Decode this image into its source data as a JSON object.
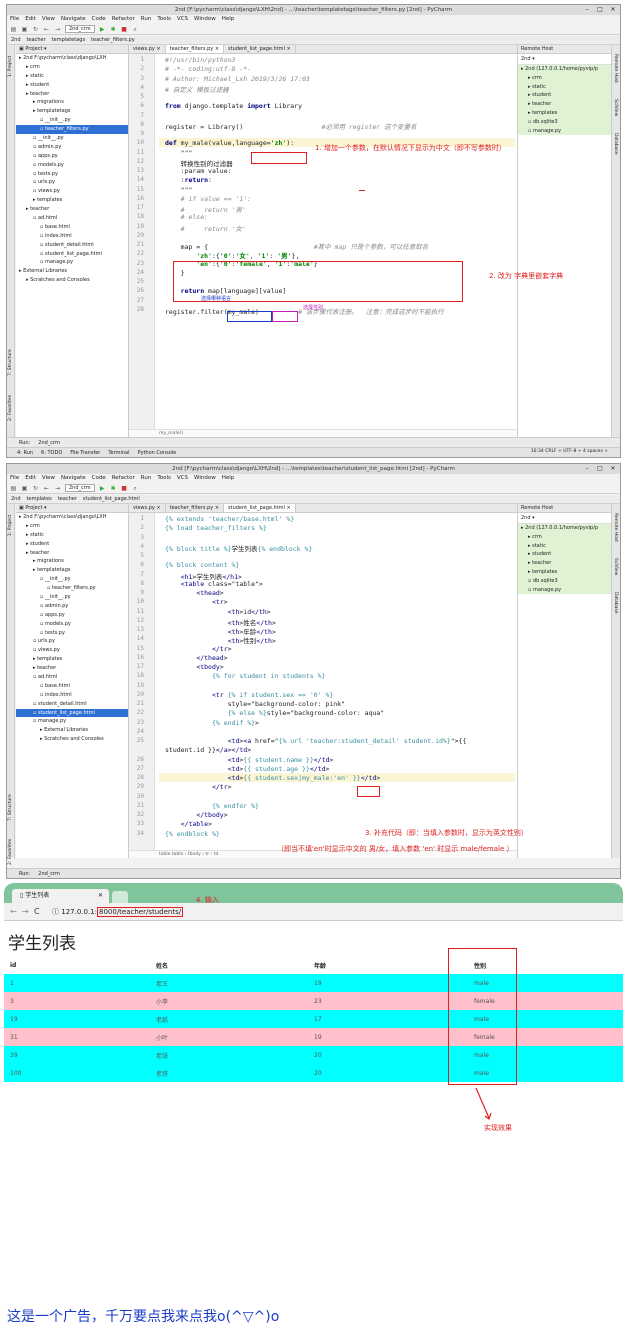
{
  "w1": {
    "title": "2nd [F:\\pycharm\\class\\django\\LXH\\2nd] - ...\\teacher\\templatetags\\teacher_filters.py [2nd] - PyCharm",
    "menu": [
      "File",
      "Edit",
      "View",
      "Navigate",
      "Code",
      "Refactor",
      "Run",
      "Tools",
      "VCS",
      "Window",
      "Help"
    ],
    "run_config": "2nd_crm",
    "crumbs": [
      "2nd",
      "teacher",
      "templatetags",
      "teacher_filters.py"
    ],
    "project_label": "Project",
    "tree": [
      "2nd  F:\\pycharm\\class\\django\\LXH",
      "crm",
      "static",
      "student",
      "teacher",
      "migrations",
      "templatetags",
      "__init__.py",
      "teacher_filters.py",
      "__init__.py",
      "admin.py",
      "apps.py",
      "models.py",
      "tests.py",
      "urls.py",
      "views.py",
      "templates",
      "teacher",
      "ad.html",
      "base.html",
      "index.html",
      "student_detail.html",
      "student_list_page.html",
      "manage.py",
      "External Libraries",
      "Scratches and Consoles"
    ],
    "tabs": [
      "views.py",
      "teacher_filters.py",
      "student_list_page.html"
    ],
    "code": [
      "#!/usr/bin/python3",
      "# -*- coding:utf-8 -*-",
      "# Author: Michael_Lxh 2019/3/26 17:03",
      "# 自定义 模板过滤器",
      "",
      "from django.template import Library",
      "",
      "register = Library()                    #必须用 register 这个变量名",
      "",
      "def my_male(value,language='zh'):",
      "    \"\"\"",
      "    转换性别的过滤器",
      "    :param value:",
      "    :return:",
      "    \"\"\"",
      "    # if value == '1':",
      "    #     return '男'",
      "    # else:",
      "    #     return '女'",
      "",
      "    map = {                           #其中 map 只是个参数，可以任意取名",
      "        'zh':{'0':'女', '1': '男'},",
      "        'en':{'0':'female', '1':'male'}",
      "    }",
      "",
      "    return map[language][value]",
      "",
      "register.filter(my_male)          # 该步骤代表注册。  注意：完成这步时不能执行"
    ],
    "remote_title": "Remote Host",
    "remote_server": "2nd",
    "remote_tree": [
      "2nd (127.0.0.1/home/pyvip/p",
      "crm",
      "static",
      "student",
      "teacher",
      "templates",
      "db.sqlite3",
      "manage.py"
    ],
    "editor_footer": "my_male()",
    "run_label": "Run:",
    "run_tab": "2nd_crm",
    "bottom_tabs": [
      "4: Run",
      "6: TODO",
      "File Transfer",
      "Terminal",
      "Python Console"
    ],
    "status": "10:34  CRLF ÷  UTF-8 ÷  4 spaces ÷",
    "event_log": "Event Log",
    "side_left": [
      "1: Project",
      "7: Structure",
      "2: Favorites"
    ],
    "side_right": [
      "Remote Host",
      "SciView",
      "Database"
    ],
    "ann1": "1. 增加一个参数，在默认情况下显示为中文（即不写参数时）",
    "ann2": "2. 改为 字典里嵌套字典",
    "ann_blue": "选择哪种语言",
    "ann_mag": "选择性别"
  },
  "w2": {
    "title": "2nd [F:\\pycharm\\class\\django\\LXH\\2nd] - ...\\templates\\teacher\\student_list_page.html [2nd] - PyCharm",
    "crumbs": [
      "2nd",
      "templates",
      "teacher",
      "student_list_page.html"
    ],
    "tree": [
      "2nd  F:\\pycharm\\class\\django\\LXH",
      "crm",
      "static",
      "student",
      "teacher",
      "migrations",
      "templatetags",
      "__init__.py",
      "teacher_filters.py",
      "__init__.py",
      "admin.py",
      "apps.py",
      "models.py",
      "tests.py",
      "urls.py",
      "views.py",
      "templates",
      "teacher",
      "ad.html",
      "base.html",
      "index.html",
      "student_detail.html",
      "student_list_page.html",
      "manage.py",
      "External Libraries",
      "Scratches and Consoles"
    ],
    "code": [
      "{% extends 'teacher/base.html' %}",
      "{% load teacher_filters %}",
      "",
      "{% block title %}学生列表{% endblock %}",
      "",
      "{% block content %}",
      "    <h1>学生列表</h1>",
      "    <table class=\"table\">",
      "        <thead>",
      "            <tr>",
      "                <th>id</th>",
      "                <th>姓名</th>",
      "                <th>年龄</th>",
      "                <th>性别</th>",
      "            </tr>",
      "        </thead>",
      "        <tbody>",
      "            {% for student in students %}",
      "",
      "            <tr {% if student.sex == '0' %}",
      "                style=\"background-color: pink\"",
      "                {% else %}style=\"background-color: aqua\"",
      "            {% endif %}>",
      "",
      "                <td><a href=\"{% url 'teacher:student_detail' student.id%}\">{{",
      "student.id }}</a></td>",
      "                <td>{{ student.name }}</td>",
      "                <td>{{ student.age }}</td>",
      "                <td>{{ student.sex|my_male:'en' }}</td>",
      "            </tr>",
      "",
      "            {% endfor %}",
      "        </tbody>",
      "    </table>",
      "{% endblock %}"
    ],
    "line_numbers": [
      "1",
      "2",
      "3",
      "4",
      "5",
      "6",
      "7",
      "8",
      "9",
      "10",
      "11",
      "12",
      "13",
      "14",
      "15",
      "16",
      "17",
      "18",
      "19",
      "20",
      "21",
      "22",
      "23",
      "24",
      "25",
      "",
      "26",
      "27",
      "28",
      "29",
      "30",
      "31",
      "32",
      "33",
      "34"
    ],
    "remote_tree": [
      "2nd (127.0.0.1/home/pyvip/p",
      "crm",
      "static",
      "student",
      "teacher",
      "templates",
      "db.sqlite3",
      "manage.py"
    ],
    "editor_footer": "table.table  ›  tbody  ›  tr  ›  td",
    "ann3": "3. 补充代码（即：当填入参数时，显示为英文性别）",
    "ann3b": "（即当不填'en'时显示中文的 男/女，填入参数 'en' 时显示 male/female ）"
  },
  "browser": {
    "tab_title": "学生列表",
    "url_host": "127.0.0.1:",
    "url_path": "8000/teacher/students/",
    "ann4": "4. 输入",
    "heading": "学生列表",
    "headers": [
      "id",
      "姓名",
      "年龄",
      "性别"
    ],
    "rows": [
      {
        "id": "1",
        "name": "老王",
        "age": "19",
        "sex": "male",
        "bg": "#00ffff"
      },
      {
        "id": "3",
        "name": "小李",
        "age": "23",
        "sex": "female",
        "bg": "#ffc0cb"
      },
      {
        "id": "19",
        "name": "老纸",
        "age": "17",
        "sex": "male",
        "bg": "#00ffff"
      },
      {
        "id": "31",
        "name": "小叶",
        "age": "19",
        "sex": "female",
        "bg": "#ffc0cb"
      },
      {
        "id": "39",
        "name": "老张",
        "age": "20",
        "sex": "male",
        "bg": "#00ffff"
      },
      {
        "id": "100",
        "name": "老铁",
        "age": "20",
        "sex": "male",
        "bg": "#00ffff"
      }
    ],
    "ann5": "实现效果"
  },
  "ad": "这是一个广告，千万要点我来点我o(^▽^)o"
}
